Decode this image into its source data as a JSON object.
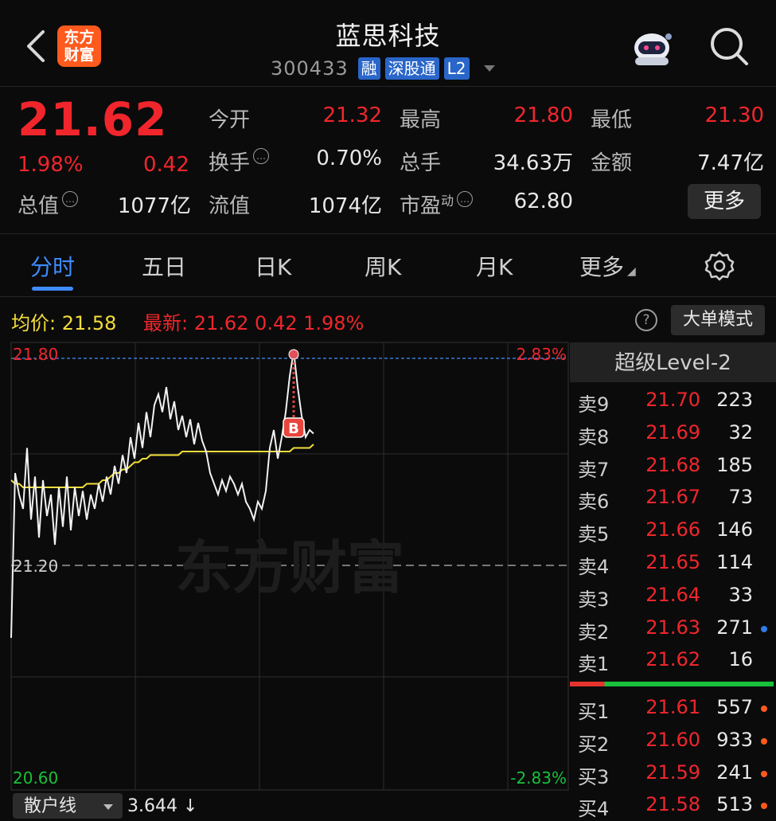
{
  "header": {
    "logo_line1": "东方",
    "logo_line2": "财富",
    "stock_name": "蓝思科技",
    "stock_code": "300433",
    "tags": [
      "融",
      "深股通",
      "L2"
    ]
  },
  "quote": {
    "price": "21.62",
    "change_pct": "1.98%",
    "change": "0.42",
    "fields": [
      {
        "label": "今开",
        "value": "21.32",
        "color": "red"
      },
      {
        "label": "最高",
        "value": "21.80",
        "color": "red"
      },
      {
        "label": "最低",
        "value": "21.30",
        "color": "red"
      },
      {
        "label": "换手",
        "value": "0.70%",
        "color": "white",
        "info": true
      },
      {
        "label": "总手",
        "value": "34.63万",
        "color": "white"
      },
      {
        "label": "金额",
        "value": "7.47亿",
        "color": "white"
      },
      {
        "label": "总值",
        "value": "1077亿",
        "color": "white",
        "info": true
      },
      {
        "label": "流值",
        "value": "1074亿",
        "color": "white"
      },
      {
        "label": "市盈",
        "sup": "动",
        "value": "62.80",
        "color": "white",
        "info": true
      }
    ],
    "more_label": "更多"
  },
  "tabs": [
    {
      "label": "分时",
      "active": true
    },
    {
      "label": "五日"
    },
    {
      "label": "日K"
    },
    {
      "label": "周K"
    },
    {
      "label": "月K"
    },
    {
      "label": "更多"
    }
  ],
  "info_row": {
    "avg_text": "均价: 21.58",
    "latest_text": "最新: 21.62  0.42  1.98%",
    "help_icon": "?",
    "mode_button": "大单模式"
  },
  "chart_data": {
    "type": "line",
    "watermark": "东方财富",
    "y_labels": {
      "top": "21.80",
      "mid": "21.20",
      "bottom": "20.60"
    },
    "pct_labels": {
      "top": "2.83%",
      "bottom": "-2.83%"
    },
    "ylim": [
      20.6,
      21.8
    ],
    "buy_marker": "B",
    "price_series": [
      21.02,
      21.48,
      21.42,
      21.38,
      21.55,
      21.35,
      21.47,
      21.3,
      21.46,
      21.36,
      21.42,
      21.28,
      21.44,
      21.33,
      21.47,
      21.32,
      21.44,
      21.36,
      21.43,
      21.35,
      21.42,
      21.38,
      21.45,
      21.4,
      21.47,
      21.42,
      21.5,
      21.45,
      21.53,
      21.48,
      21.58,
      21.52,
      21.62,
      21.55,
      21.65,
      21.58,
      21.67,
      21.7,
      21.65,
      21.72,
      21.63,
      21.68,
      21.6,
      21.64,
      21.58,
      21.63,
      21.56,
      21.62,
      21.57,
      21.54,
      21.48,
      21.45,
      21.42,
      21.46,
      21.43,
      21.47,
      21.45,
      21.42,
      21.45,
      21.4,
      21.38,
      21.35,
      21.4,
      21.38,
      21.43,
      21.55,
      21.6,
      21.52,
      21.58,
      21.65,
      21.75,
      21.82,
      21.72,
      21.64,
      21.58,
      21.6,
      21.59
    ],
    "avg_series": [
      21.46,
      21.45,
      21.45,
      21.44,
      21.44,
      21.44,
      21.44,
      21.44,
      21.44,
      21.44,
      21.44,
      21.44,
      21.44,
      21.44,
      21.44,
      21.44,
      21.44,
      21.44,
      21.44,
      21.45,
      21.45,
      21.45,
      21.45,
      21.46,
      21.46,
      21.47,
      21.48,
      21.48,
      21.49,
      21.49,
      21.5,
      21.51,
      21.51,
      21.52,
      21.52,
      21.53,
      21.53,
      21.53,
      21.53,
      21.53,
      21.53,
      21.53,
      21.53,
      21.54,
      21.54,
      21.54,
      21.54,
      21.54,
      21.54,
      21.54,
      21.54,
      21.54,
      21.54,
      21.54,
      21.54,
      21.54,
      21.54,
      21.54,
      21.54,
      21.54,
      21.54,
      21.54,
      21.54,
      21.54,
      21.54,
      21.54,
      21.54,
      21.54,
      21.54,
      21.54,
      21.54,
      21.55,
      21.55,
      21.55,
      21.55,
      21.55,
      21.56
    ]
  },
  "order_book": {
    "title": "超级Level-2",
    "asks": [
      {
        "side": "卖9",
        "price": "21.70",
        "vol": "223"
      },
      {
        "side": "卖8",
        "price": "21.69",
        "vol": "32"
      },
      {
        "side": "卖7",
        "price": "21.68",
        "vol": "185"
      },
      {
        "side": "卖6",
        "price": "21.67",
        "vol": "73"
      },
      {
        "side": "卖5",
        "price": "21.66",
        "vol": "146"
      },
      {
        "side": "卖4",
        "price": "21.65",
        "vol": "114"
      },
      {
        "side": "卖3",
        "price": "21.64",
        "vol": "33"
      },
      {
        "side": "卖2",
        "price": "21.63",
        "vol": "271",
        "dot": "#2f7de8"
      },
      {
        "side": "卖1",
        "price": "21.62",
        "vol": "16"
      }
    ],
    "bids": [
      {
        "side": "买1",
        "price": "21.61",
        "vol": "557",
        "dot": "#ff5a1d"
      },
      {
        "side": "买2",
        "price": "21.60",
        "vol": "933",
        "dot": "#ff5a1d"
      },
      {
        "side": "买3",
        "price": "21.59",
        "vol": "241",
        "dot": "#ff5a1d"
      },
      {
        "side": "买4",
        "price": "21.58",
        "vol": "513",
        "dot": "#ff5a1d"
      }
    ],
    "buy_ratio": 0.17
  },
  "bottom": {
    "retail_label": "散户线",
    "retail_value": "3.644 ↓"
  },
  "colors": {
    "up": "#f0262c",
    "down": "#19c13a",
    "accent": "#3f8bff",
    "avg": "#f3dd3a"
  }
}
